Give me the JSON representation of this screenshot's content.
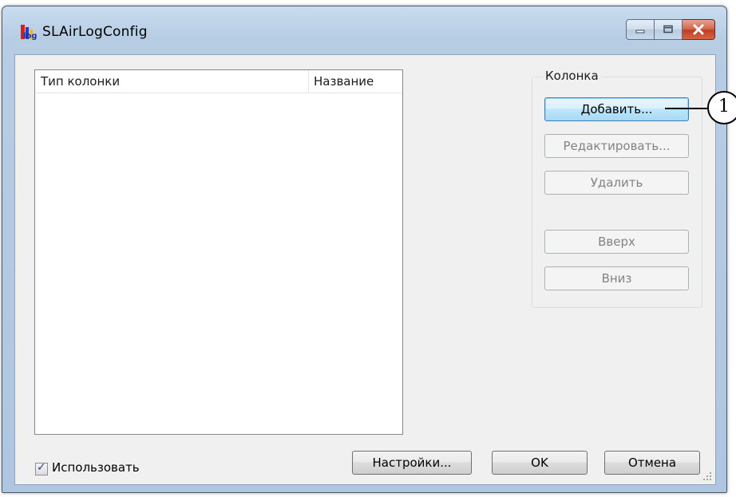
{
  "window": {
    "title": "SLAirLogConfig",
    "icon": "app-logo-icon",
    "caption_buttons": [
      "minimize-icon",
      "maximize-icon",
      "close-icon"
    ]
  },
  "list": {
    "columns": [
      "Тип колонки",
      "Название"
    ],
    "rows": []
  },
  "column_group": {
    "legend": "Колонка",
    "buttons": {
      "add": "Добавить...",
      "edit": "Редактировать...",
      "delete": "Удалить",
      "up": "Вверх",
      "down": "Вниз"
    }
  },
  "footer": {
    "use_label": "Использовать",
    "use_checked": true,
    "settings": "Настройки...",
    "ok": "OK",
    "cancel": "Отмена"
  },
  "callout": {
    "number": "1"
  },
  "colors": {
    "default_button_border": "#3c7fb1",
    "close_button": "#c13e22",
    "disabled_text": "#838383"
  }
}
